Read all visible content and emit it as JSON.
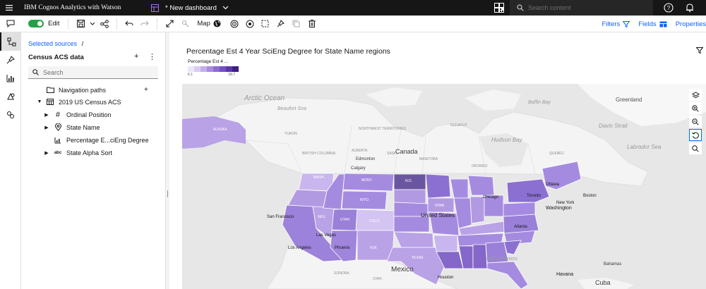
{
  "topbar": {
    "app_title": "IBM Cognos Analytics with Watson",
    "dashboard_title": "* New dashboard",
    "search_placeholder": "Search content"
  },
  "toolbar": {
    "edit_label": "Edit",
    "map_label": "Map",
    "filters_label": "Filters",
    "fields_label": "Fields",
    "properties_label": "Properties",
    "toggle_state": "on"
  },
  "panel": {
    "breadcrumb_source": "Selected sources",
    "breadcrumb_sep": "/",
    "title": "Census ACS data",
    "search_placeholder": "Search",
    "tree": [
      {
        "label": "Navigation paths",
        "icon": "folder-icon"
      },
      {
        "label": "2019 US Census ACS",
        "icon": "table-icon"
      },
      {
        "label": "Ordinal Position",
        "icon": "hash-icon"
      },
      {
        "label": "State Name",
        "icon": "location-icon"
      },
      {
        "label": "Percentage E...ciEng Degree",
        "icon": "measure-icon"
      },
      {
        "label": "State Alpha Sort",
        "icon": "text-type-icon"
      }
    ]
  },
  "visualization": {
    "title": "Percentage Est 4 Year SciEng Degree for State Name regions",
    "legend_title": "Percentage Est 4 ...",
    "legend_min": "6.1",
    "legend_max": "18.7",
    "legend_colors": [
      "#ece7f8",
      "#d9ccf2",
      "#c3aeea",
      "#a98ddf",
      "#8f6cd2",
      "#7550c0",
      "#5c36a8",
      "#3f1e85"
    ],
    "map_labels": {
      "arctic_ocean": "Arctic Ocean",
      "beaufort_sea": "Beaufort Sea",
      "greenland": "Greenland",
      "baffin_bay": "Baffin Bay",
      "davis_strait": "Davis Strait",
      "labrador_sea": "Labrador Sea",
      "alaska": "ALASKA",
      "yukon": "YUKON",
      "northwest_territories": "NORTHWEST TERRITORIES",
      "nunavut": "NUNAVUT",
      "hudson_bay": "Hudson Bay",
      "british_columbia": "BRITISH COLUMBIA",
      "alberta": "ALBERTA",
      "saskatchewan": "SASK.",
      "manitoba": "MANITOBA",
      "ontario": "ONTARIO",
      "quebec": "QUEBEC",
      "canada": "Canada",
      "edmonton": "Edmonton",
      "calgary": "Calgary",
      "wash": "WASH.",
      "mont": "MONT.",
      "n_d": "N.D.",
      "wyo": "WYO.",
      "utah": "UTAH",
      "colo": "COLO.",
      "nev": "NEV.",
      "iowa": "IOWA",
      "united_states": "United States",
      "san_francisco": "San Francisco",
      "las_vegas": "Las Vegas",
      "los_angeles": "Los Angeles",
      "phoenix": "Phoenix",
      "n_m": "N.M.",
      "texas": "TEXAS",
      "houston": "Houston",
      "chicago": "Chicago",
      "ottawa": "Ottawa",
      "toronto": "Toronto",
      "boston": "Boston",
      "new_york": "New York",
      "washington": "Washington",
      "atlanta": "Atlanta",
      "sonora": "SONORA",
      "chih": "CHIH.",
      "mexico": "Mexico",
      "gulf_of_mexico": "Gulf of Mexico",
      "havana": "Havana",
      "bahamas": "Bahamas",
      "cuba": "Cuba"
    }
  }
}
